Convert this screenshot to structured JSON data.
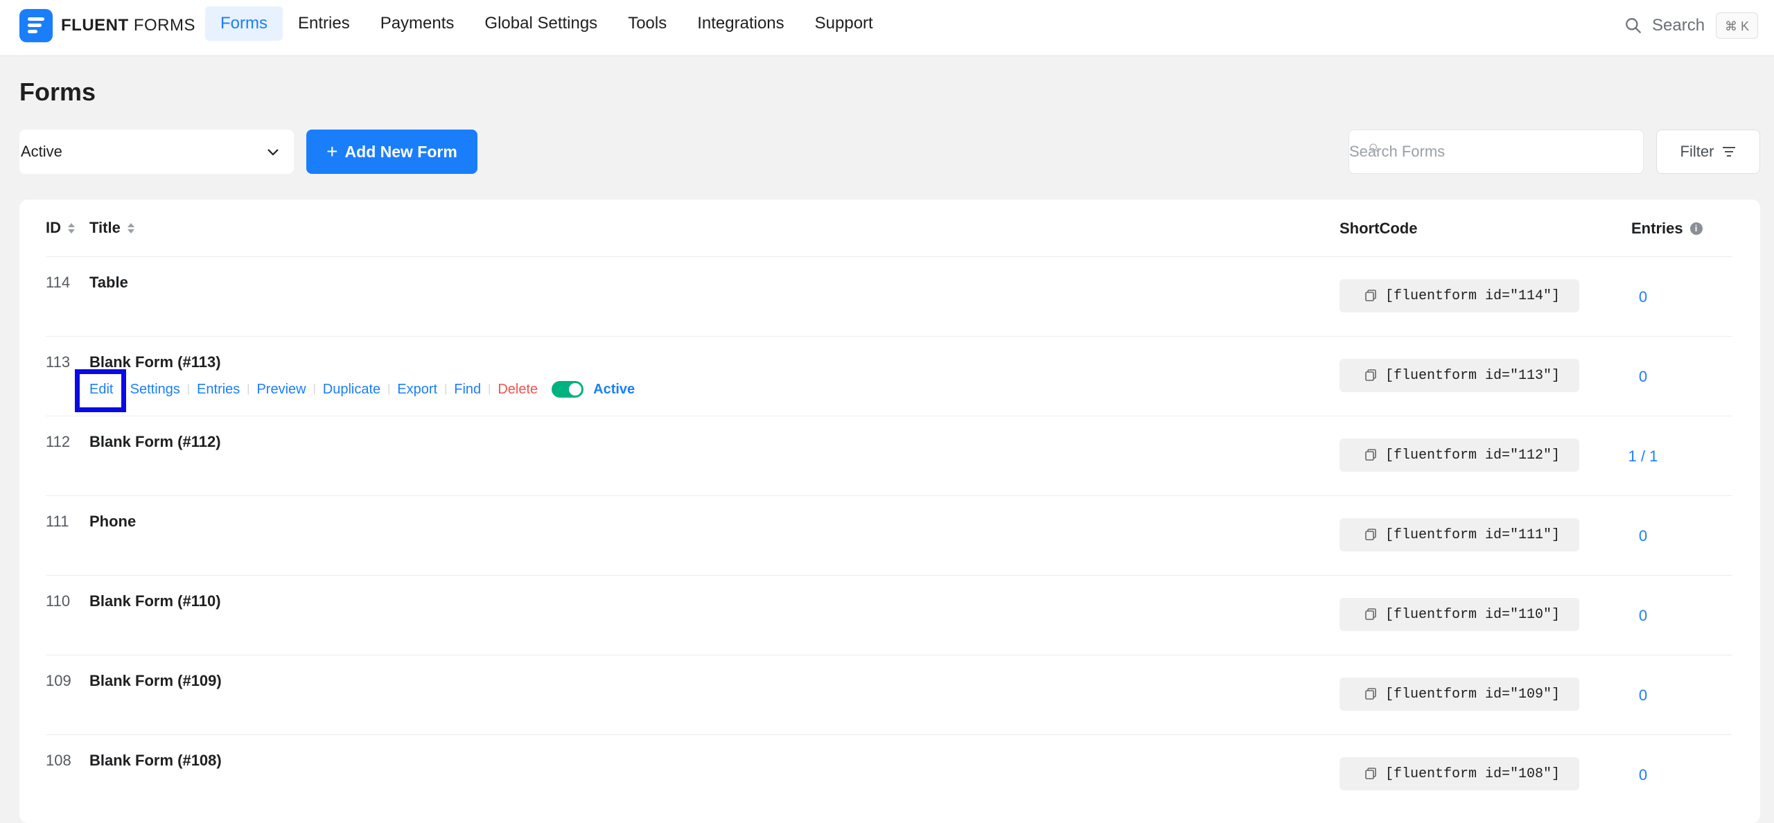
{
  "app": {
    "brand_bold": "FLUENT",
    "brand_light": " FORMS"
  },
  "nav": {
    "items": [
      {
        "label": "Forms",
        "active": true
      },
      {
        "label": "Entries",
        "active": false
      },
      {
        "label": "Payments",
        "active": false
      },
      {
        "label": "Global Settings",
        "active": false
      },
      {
        "label": "Tools",
        "active": false
      },
      {
        "label": "Integrations",
        "active": false
      },
      {
        "label": "Support",
        "active": false
      }
    ],
    "search_label": "Search",
    "search_shortcut": "⌘ K"
  },
  "page": {
    "title": "Forms",
    "status_filter": "Active",
    "add_button": "Add New Form",
    "search_placeholder": "Search Forms",
    "filter_button": "Filter"
  },
  "table": {
    "headers": {
      "id": "ID",
      "title": "Title",
      "shortcode": "ShortCode",
      "entries": "Entries"
    },
    "rows": [
      {
        "id": "114",
        "title": "Table",
        "shortcode": "[fluentform id=\"114\"]",
        "entries": "0"
      },
      {
        "id": "113",
        "title": "Blank Form (#113)",
        "shortcode": "[fluentform id=\"113\"]",
        "entries": "0"
      },
      {
        "id": "112",
        "title": "Blank Form (#112)",
        "shortcode": "[fluentform id=\"112\"]",
        "entries": "1 / 1"
      },
      {
        "id": "111",
        "title": "Phone",
        "shortcode": "[fluentform id=\"111\"]",
        "entries": "0"
      },
      {
        "id": "110",
        "title": "Blank Form (#110)",
        "shortcode": "[fluentform id=\"110\"]",
        "entries": "0"
      },
      {
        "id": "109",
        "title": "Blank Form (#109)",
        "shortcode": "[fluentform id=\"109\"]",
        "entries": "0"
      },
      {
        "id": "108",
        "title": "Blank Form (#108)",
        "shortcode": "[fluentform id=\"108\"]",
        "entries": "0"
      }
    ],
    "row_actions": {
      "edit": "Edit",
      "settings": "Settings",
      "entries": "Entries",
      "preview": "Preview",
      "duplicate": "Duplicate",
      "export": "Export",
      "find": "Find",
      "delete": "Delete",
      "status_label": "Active"
    }
  },
  "colors": {
    "accent": "#1a7efb",
    "danger": "#ef5350",
    "toggle_on": "#00b27f",
    "highlight": "#0a0ae6"
  }
}
